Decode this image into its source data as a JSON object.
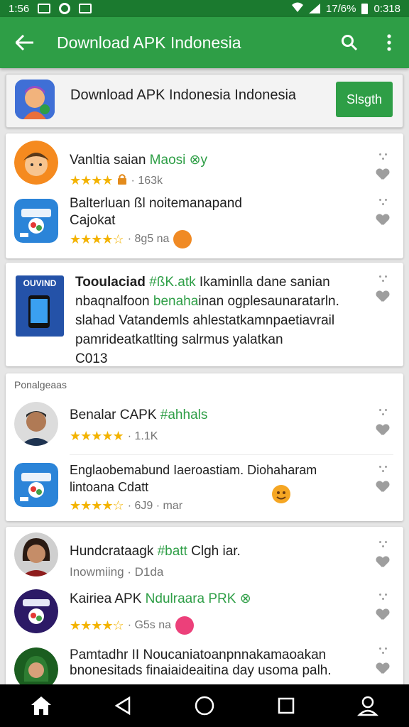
{
  "status_bar": {
    "time": "1:56",
    "battery": "17/6%",
    "clock": "0:318"
  },
  "app_bar": {
    "title": "Download APK Indonesia"
  },
  "search_card": {
    "text": "Download APK Indonesia Indonesia",
    "button_label": "Slsgth"
  },
  "group1": [
    {
      "name": "Vanltia saian",
      "name_accent": "Maosi ⊗y",
      "stars": "★★★★",
      "meta": "· 163k"
    },
    {
      "name": "Balterluan ßl noitemanapand",
      "sub": "Cajokat",
      "stars": "★★★★☆",
      "meta": "· 8g5 na"
    }
  ],
  "feature": {
    "icon_label": "OUVIND",
    "line1_a": "Tooulaciad ",
    "line1_accent": "#ßK.atk",
    "line1_b": " Ikaminlla dane sanian",
    "line2_a": "nbaqnalfoon ",
    "line2_accent": "benaha",
    "line2_b": "inan ogplesaunaratarln.",
    "line3": "slahad Vatandemls ahlestatkamnpaetiavrail",
    "line4": "pamrideatkatlting salrmus yalatkan",
    "line5": "C013"
  },
  "group2": {
    "label": "Ponalgeaas",
    "items": [
      {
        "name": "Benalar CAPK ",
        "name_accent": "#ahhals",
        "stars": "★★★★★",
        "meta": "· 1.1K"
      },
      {
        "name": "Englaobemabund Iaeroastiam. Diohaharam",
        "sub": "lintoana Cdatt",
        "stars": "★★★★☆",
        "meta": "· 6J9 · mar"
      }
    ]
  },
  "group3": [
    {
      "name": "Hundcrataagk ",
      "name_accent": "#batt",
      "name_tail": " Clgh iar.",
      "sub": "Inowmiing  · D1da"
    },
    {
      "name": "Kairiea APK ",
      "name_accent": "Ndulraara PRK ⊗",
      "stars": "★★★★☆",
      "meta": "· G5s na"
    },
    {
      "name": "Pamtadhr II Noucaniatoanpnnakamaoakan",
      "sub": "bnonesitads finaiaideaitina day usoma palh."
    }
  ],
  "colors": {
    "app_bar": "#2e9e46",
    "status_bar": "#1b7a2f",
    "accent_text": "#2e9e46",
    "star": "#f3b300"
  }
}
